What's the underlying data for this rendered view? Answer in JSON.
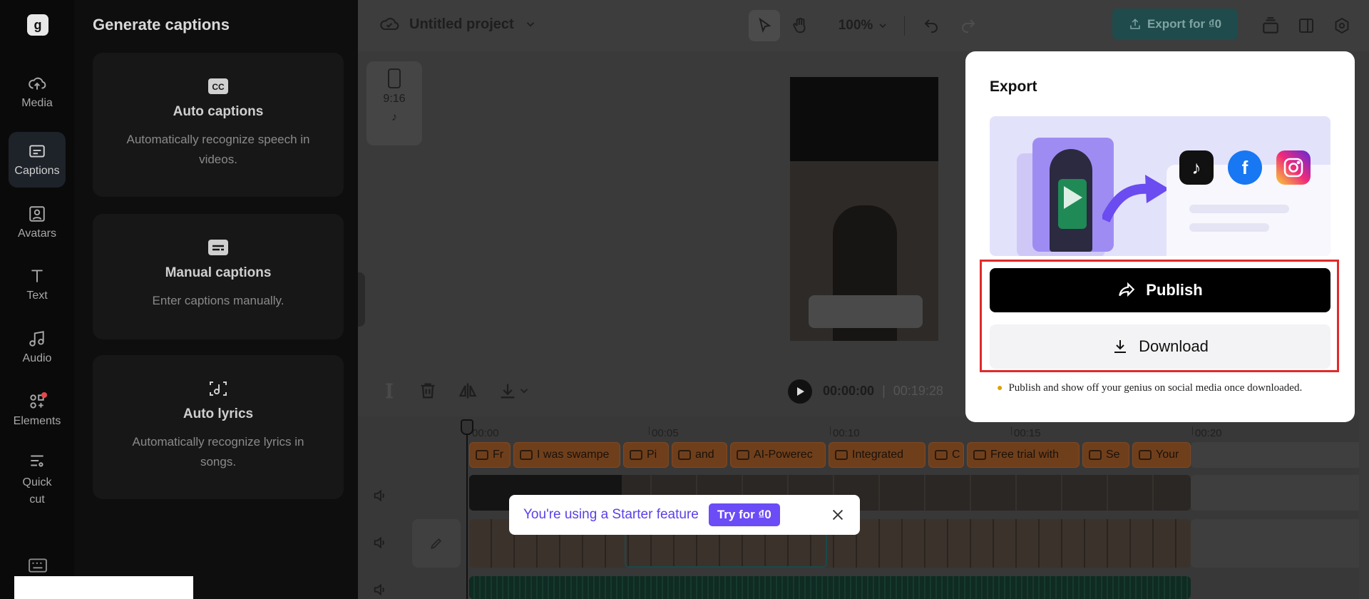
{
  "rail": {
    "items": [
      {
        "label": "Media",
        "icon": "cloud-upload-icon"
      },
      {
        "label": "Captions",
        "icon": "captions-icon",
        "active": true
      },
      {
        "label": "Avatars",
        "icon": "avatar-icon"
      },
      {
        "label": "Text",
        "icon": "text-icon"
      },
      {
        "label": "Audio",
        "icon": "music-icon"
      },
      {
        "label": "Elements",
        "icon": "elements-icon"
      },
      {
        "label": "Quick cut",
        "icon": "quick-cut-icon"
      }
    ]
  },
  "panel": {
    "title": "Generate captions",
    "cards": [
      {
        "title": "Auto captions",
        "desc": "Automatically recognize speech in videos.",
        "icon": "cc-icon"
      },
      {
        "title": "Manual captions",
        "desc": "Enter captions manually.",
        "icon": "subtitle-icon"
      },
      {
        "title": "Auto lyrics",
        "desc": "Automatically recognize lyrics in songs.",
        "icon": "lyrics-icon"
      }
    ]
  },
  "topbar": {
    "project_name": "Untitled project",
    "zoom": "100%",
    "export_label": "Export for ₫0"
  },
  "canvas": {
    "ratio": "9:16"
  },
  "playback": {
    "current": "00:00:00",
    "separator": "|",
    "duration": "00:19:28"
  },
  "timeline": {
    "ruler": [
      "00:00",
      "00:05",
      "00:10",
      "00:15",
      "00:20"
    ],
    "captions": [
      "Fr",
      "I was swampe",
      "Pi",
      "and",
      "AI-Powerec",
      "Integrated",
      "C",
      "Free trial with",
      "Se",
      "Your"
    ]
  },
  "starter": {
    "message": "You're using a Starter feature",
    "try_label": "Try for ₫0"
  },
  "export_modal": {
    "title": "Export",
    "publish_label": "Publish",
    "download_label": "Download",
    "hint": "Publish and show off your genius on social media once downloaded."
  },
  "colors": {
    "accent_publish": "#000000",
    "highlight": "#e02a2a",
    "starter_purple": "#6b4cf6"
  }
}
